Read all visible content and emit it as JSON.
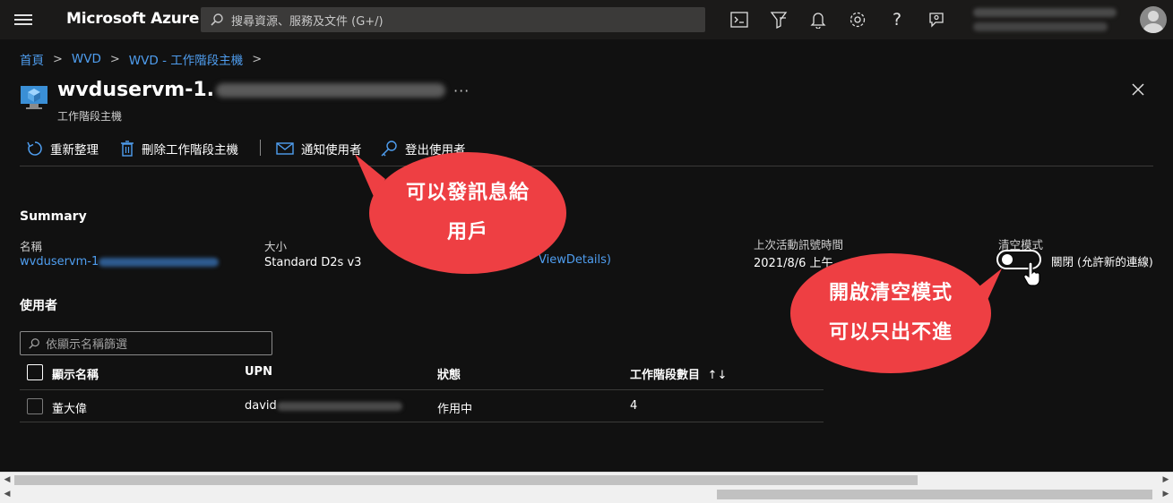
{
  "topbar": {
    "brand": "Microsoft Azure",
    "search_placeholder": "搜尋資源、服務及文件 (G+/)",
    "icons": [
      "cloud-shell-icon",
      "directory-filter-icon",
      "notifications-icon",
      "settings-icon",
      "help-icon",
      "feedback-icon"
    ]
  },
  "breadcrumb": {
    "items": [
      "首頁",
      "WVD",
      "WVD - 工作階段主機"
    ]
  },
  "header": {
    "title_prefix": "wvduservm-1.",
    "subtitle": "工作階段主機",
    "more": "···"
  },
  "commands": {
    "refresh": "重新整理",
    "delete": "刪除工作階段主機",
    "notify": "通知使用者",
    "logoff": "登出使用者"
  },
  "summary": {
    "heading": "Summary",
    "name_label": "名稱",
    "name_value_prefix": "wvduservm-1",
    "size_label": "大小",
    "size_value": "Standard D2s v3",
    "details_link_suffix": "ViewDetails)",
    "heartbeat_label": "上次活動訊號時間",
    "heartbeat_value": "2021/8/6 上午",
    "drain_label": "清空模式",
    "drain_state": "關閉 (允許新的連線)",
    "drain_on": false
  },
  "users": {
    "heading": "使用者",
    "filter_placeholder": "依顯示名稱篩選",
    "columns": [
      "顯示名稱",
      "UPN",
      "狀態",
      "工作階段數目"
    ],
    "sort_glyph": "↑↓",
    "rows": [
      {
        "display_name": "董大偉",
        "upn_prefix": "david",
        "status": "作用中",
        "sessions": "4"
      }
    ]
  },
  "callouts": {
    "notify": [
      "可以發訊息給",
      "用戶"
    ],
    "drain": [
      "開啟清空模式",
      "可以只出不進"
    ],
    "color": "#ee3f43"
  },
  "colors": {
    "link": "#4f9ef0",
    "topbar_bg": "#1b1a19",
    "page_bg": "#111111"
  }
}
